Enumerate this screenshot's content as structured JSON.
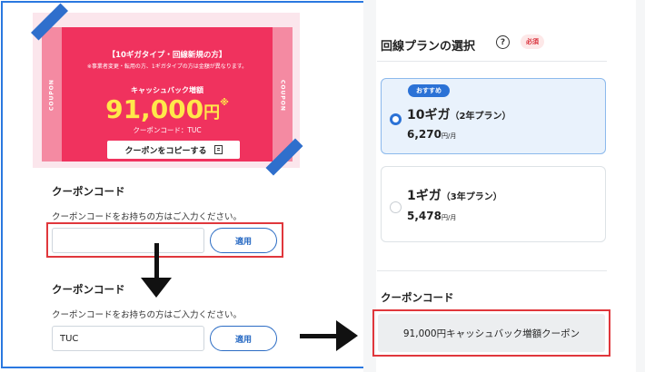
{
  "coupon": {
    "title": "【10ギガタイプ・回線新規の方】",
    "note": "※事業者変更・転用の方、1ギガタイプの方は金額が異なります。",
    "label": "キャッシュバック増額",
    "amount": "91,000",
    "amount_unit": "円",
    "amount_mark": "※",
    "code_label": "クーポンコード：TUC",
    "copy_button": "クーポンをコピーする",
    "side_text": "COUPON",
    "colors": {
      "main": "#f0325e",
      "side": "#f48aa2",
      "amount": "#ffe84a",
      "ribbon": "#2f6fcc"
    }
  },
  "before": {
    "heading": "クーポンコード",
    "description": "クーポンコードをお持ちの方はご入力ください。",
    "input_value": "",
    "apply_button": "適用"
  },
  "after": {
    "heading": "クーポンコード",
    "description": "クーポンコードをお持ちの方はご入力ください。",
    "input_value": "TUC",
    "apply_button": "適用"
  },
  "plan_selection": {
    "heading": "回線プランの選択",
    "help_icon": "?",
    "required_badge": "必須",
    "plans": [
      {
        "badge": "おすすめ",
        "name": "10ギガ",
        "term": "（2年プラン）",
        "price": "6,270",
        "price_unit": "円/月",
        "selected": true
      },
      {
        "badge": "",
        "name": "1ギガ",
        "term": "（3年プラン）",
        "price": "5,478",
        "price_unit": "円/月",
        "selected": false
      }
    ]
  },
  "applied": {
    "heading": "クーポンコード",
    "coupon_text": "91,000円キャッシュバック増額クーポン"
  },
  "colors": {
    "frame": "#2a78e0",
    "highlight": "#e0373c",
    "accent": "#2b72d6"
  }
}
